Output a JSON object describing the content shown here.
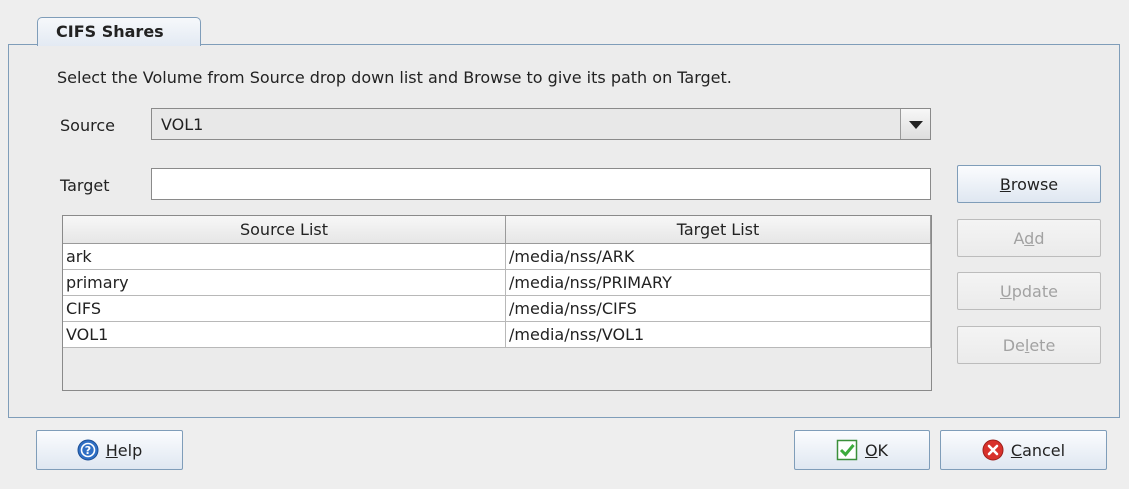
{
  "tab": {
    "label": "CIFS Shares"
  },
  "instruction": "Select the Volume from Source drop down list and Browse to give its path on Target.",
  "source": {
    "label": "Source",
    "value": "VOL1"
  },
  "target": {
    "label": "Target",
    "value": ""
  },
  "table": {
    "columns": [
      "Source List",
      "Target List"
    ],
    "rows": [
      [
        "ark",
        "/media/nss/ARK"
      ],
      [
        "primary",
        "/media/nss/PRIMARY"
      ],
      [
        "CIFS",
        "/media/nss/CIFS"
      ],
      [
        "VOL1",
        "/media/nss/VOL1"
      ]
    ]
  },
  "buttons": {
    "browse": {
      "label": "Browse",
      "mnemonic": "B",
      "rest": "rowse"
    },
    "add": {
      "label": "Add",
      "pre": "A",
      "mnemonic": "d",
      "rest": "d"
    },
    "update": {
      "label": "Update",
      "mnemonic": "U",
      "rest": "pdate"
    },
    "delete": {
      "label": "Delete",
      "pre": "De",
      "mnemonic": "l",
      "rest": "ete"
    },
    "help": {
      "label": "Help",
      "mnemonic": "H",
      "rest": "elp"
    },
    "ok": {
      "label": "OK",
      "mnemonic": "O",
      "rest": "K"
    },
    "cancel": {
      "label": "Cancel",
      "mnemonic": "C",
      "rest": "ancel"
    }
  },
  "icons": {
    "help": "help-icon",
    "ok": "check-icon",
    "cancel": "cancel-icon"
  },
  "colors": {
    "accent": "#7f9db9",
    "ok_green": "#3cab3c",
    "cancel_red": "#d8312b",
    "help_blue": "#2f6fc4"
  }
}
